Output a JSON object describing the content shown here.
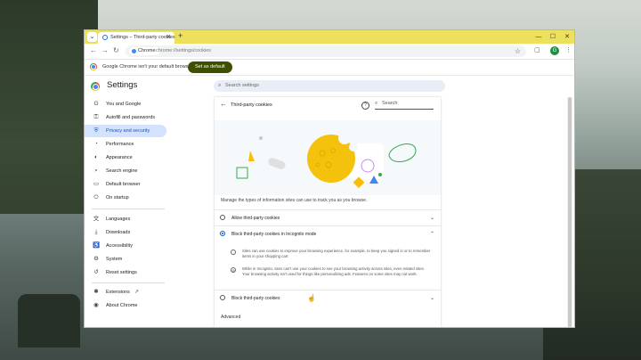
{
  "browser": {
    "tab_title": "Settings – Third-party cookies",
    "tab_close": "✕",
    "new_tab": "+",
    "window_controls": [
      "—",
      "☐",
      "✕"
    ],
    "url_chip": "Chrome",
    "url": "chrome://settings/cookies",
    "profile_initial": "G"
  },
  "infobar": {
    "message": "Google Chrome isn't your default browser",
    "button": "Set as default"
  },
  "settings": {
    "title": "Settings",
    "search_placeholder": "Search settings"
  },
  "sidebar": {
    "items": [
      {
        "icon": "G",
        "label": "You and Google"
      },
      {
        "icon": "⚿",
        "label": "Autofill and passwords"
      },
      {
        "icon": "⛨",
        "label": "Privacy and security"
      },
      {
        "icon": "◔",
        "label": "Performance"
      },
      {
        "icon": "◐",
        "label": "Appearance"
      },
      {
        "icon": "⌕",
        "label": "Search engine"
      },
      {
        "icon": "▭",
        "label": "Default browser"
      },
      {
        "icon": "⏻",
        "label": "On startup"
      },
      {
        "icon": "文",
        "label": "Languages"
      },
      {
        "icon": "⤓",
        "label": "Downloads"
      },
      {
        "icon": "♿",
        "label": "Accessibility"
      },
      {
        "icon": "⚙",
        "label": "System"
      },
      {
        "icon": "↺",
        "label": "Reset settings"
      },
      {
        "icon": "✱",
        "label": "Extensions"
      },
      {
        "icon": "◉",
        "label": "About Chrome"
      }
    ],
    "active_index": 2
  },
  "cookies_page": {
    "title": "Third-party cookies",
    "search_placeholder": "Search",
    "description": "Manage the types of information sites can use to track you as you browse.",
    "options": [
      {
        "label": "Allow third-party cookies",
        "selected": false
      },
      {
        "label": "Block third-party cookies in Incognito mode",
        "selected": true
      },
      {
        "label": "Block third-party cookies",
        "selected": false
      }
    ],
    "details": [
      "Sites can use cookies to improve your browsing experience, for example, to keep you signed in or to remember items in your shopping cart",
      "While in Incognito, sites can't use your cookies to see your browsing activity across sites, even related sites. Your browsing activity isn't used for things like personalizing ads. Features on some sites may not work."
    ],
    "advanced": "Advanced"
  },
  "colors": {
    "tabstrip": "#ede05c",
    "accent": "#0b57d0",
    "set_default_button": "#3f4f00",
    "cookie_yellow": "#f4c20d"
  }
}
